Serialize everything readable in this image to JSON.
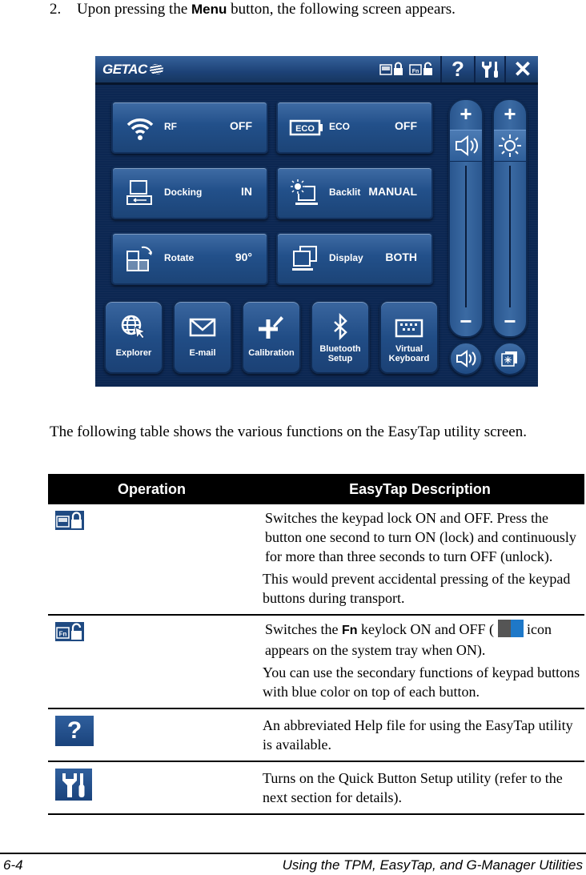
{
  "step": {
    "number": "2.",
    "text_before": "Upon pressing the ",
    "bold": "Menu",
    "text_after": " button, the following screen appears."
  },
  "easytap": {
    "brand": "GETAC",
    "titlebar_icons": [
      "keypad-lock-icon",
      "fn-lock-icon",
      "help-icon",
      "setup-icon",
      "close-icon"
    ],
    "tiles": [
      {
        "icon": "wifi-icon",
        "label": "RF",
        "value": "OFF"
      },
      {
        "icon": "eco-battery-icon",
        "label": "ECO",
        "value": "OFF"
      },
      {
        "icon": "docking-icon",
        "label": "Docking",
        "value": "IN"
      },
      {
        "icon": "backlight-icon",
        "label": "Backlit",
        "value": "MANUAL"
      },
      {
        "icon": "rotate-icon",
        "label": "Rotate",
        "value": "90°"
      },
      {
        "icon": "display-icon",
        "label": "Display",
        "value": "BOTH"
      }
    ],
    "apps": [
      {
        "icon": "globe-cursor-icon",
        "label": "Explorer"
      },
      {
        "icon": "envelope-icon",
        "label": "E-mail"
      },
      {
        "icon": "calibration-icon",
        "label": "Calibration"
      },
      {
        "icon": "bluetooth-icon",
        "label": "Bluetooth Setup"
      },
      {
        "icon": "keyboard-icon",
        "label": "Virtual Keyboard"
      }
    ],
    "sliders": [
      {
        "name": "volume",
        "plus": "+",
        "minus": "−",
        "level": 1.0
      },
      {
        "name": "brightness",
        "plus": "+",
        "minus": "−",
        "level": 1.0
      }
    ]
  },
  "intro": "The following table shows the various functions on the EasyTap utility screen.",
  "table": {
    "headers": [
      "Operation",
      "EasyTap Description"
    ],
    "rows": [
      {
        "icon": "keypad-lock-icon",
        "desc": [
          "Switches the keypad lock ON and OFF. Press the button one second to turn ON (lock) and continuously for more than three seconds to turn OFF (unlock).",
          "This would prevent accidental pressing of the keypad buttons during transport."
        ]
      },
      {
        "icon": "fn-lock-icon",
        "desc_a": "Switches the ",
        "desc_bold": "Fn",
        "desc_b": " keylock ON and OFF ( ",
        "desc_c": " icon appears on the system tray when ON).",
        "desc2": "You can use the secondary functions of keypad buttons with blue color on top of each button."
      },
      {
        "icon": "help-icon",
        "desc": [
          "An abbreviated Help file for using the EasyTap utility is available."
        ]
      },
      {
        "icon": "setup-icon",
        "desc": [
          "Turns on the Quick Button Setup utility (refer to the next section for details)."
        ]
      }
    ]
  },
  "footer": {
    "page": "6-4",
    "chapter": "Using the TPM, EasyTap, and G-Manager Utilities"
  }
}
